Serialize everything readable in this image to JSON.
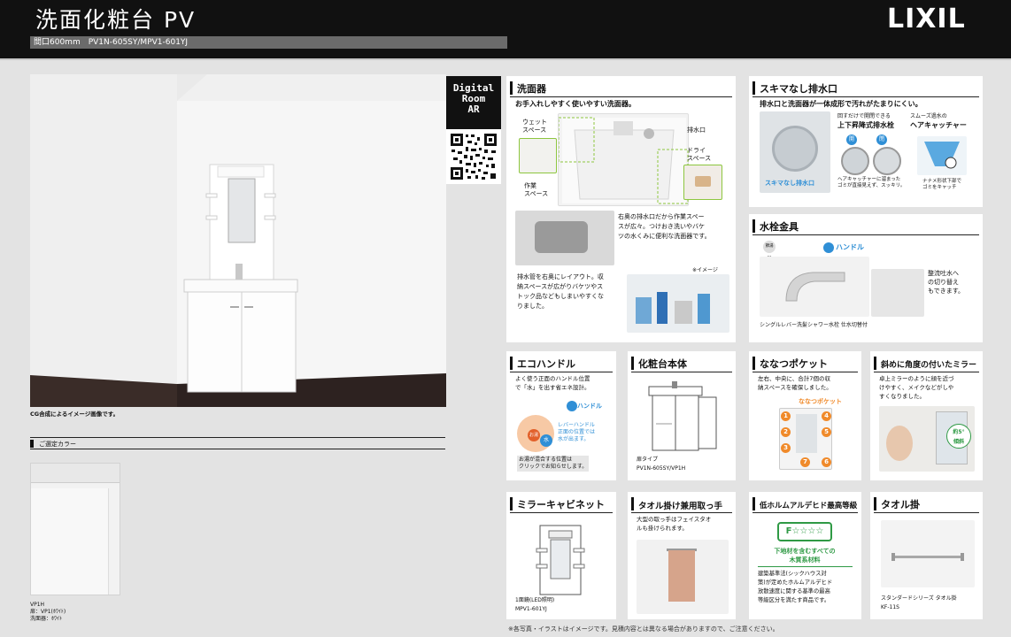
{
  "header": {
    "title": "洗面化粧台 PV",
    "subtitle": "間口600mm　PV1N-605SY/MPV1-601YJ",
    "logo": "LIXIL"
  },
  "ar": {
    "line1": "Digital",
    "line2": "Room",
    "line3": "AR"
  },
  "room": {
    "note": "CG合成によるイメージ画像です。"
  },
  "color": {
    "title": "ご選定カラー",
    "model": "VP1H",
    "door": "扉：VP1(ﾎﾜｲﾄ)",
    "bowl": "洗面器：ﾎﾜｲﾄ"
  },
  "sink": {
    "title": "洗面器",
    "lead": "お手入れしやすく使いやすい洗面器。",
    "wet": [
      "ウェット",
      "スペース"
    ],
    "drain": "排水口",
    "dry": [
      "ドライ",
      "スペース"
    ],
    "work": [
      "作業",
      "スペース"
    ],
    "desc1": [
      "右奥の排水口だから作業スペー",
      "スが広々。つけおき洗いやバケ",
      "ツの水くみに便利な洗面器です。"
    ],
    "image_note": "※イメージ",
    "desc2": [
      "排水管を右奥にレイアウト。収",
      "納スペースが広がりバケツやス",
      "トック品などもしまいやすくな",
      "りました。"
    ]
  },
  "sukima": {
    "title": "スキマなし排水口",
    "lead": "排水口と洗面器が一体成形で汚れがたまりにくい。",
    "sub1": "回すだけで開閉できる",
    "sub2": "スムーズ過水の",
    "head1": "上下昇降式排水栓",
    "head2": "ヘアキャッチャー",
    "photo_label": "スキマなし排水口",
    "cap1": [
      "ヘアキャッチャーに溜まった",
      "ゴミが直接見えず、スッキリ。"
    ],
    "cap2": [
      "ナナメ形状下部で",
      "ゴミをキャッチ"
    ],
    "open": "開",
    "close": "閉"
  },
  "faucet": {
    "title": "水栓金具",
    "badge": "節湯C1",
    "handle": "ハンドル",
    "desc": [
      "整流吐水へ",
      "の切り替え",
      "もできます。"
    ],
    "caption": "シングルレバー洗髪シャワー水栓 仕水切替付"
  },
  "eco": {
    "title": "エコハンドル",
    "desc": [
      "よく使う正面のハンドル位置",
      "で「水」を出す省エネ設計。"
    ],
    "handle": "ハンドル",
    "lever": [
      "レバーハンドル",
      "正面の位置では",
      "水が出ます。"
    ],
    "mix": [
      "お湯が混合する位置は",
      "クリックでお知らせします。"
    ],
    "hot": "お湯",
    "water": "水"
  },
  "cabinet": {
    "title": "化粧台本体",
    "type": "扉タイプ",
    "model": "PV1N-605SY/VP1H"
  },
  "pocket": {
    "title": "ななつポケット",
    "desc": [
      "左右、中央に、合計7個の収",
      "納スペースを確保しました。"
    ],
    "sub": "ななつポケット",
    "nums": [
      "1",
      "2",
      "3",
      "4",
      "5",
      "6",
      "7"
    ]
  },
  "mirror": {
    "title": "斜めに角度の付いたミラー",
    "desc": [
      "卓上ミラーのように顔を近づ",
      "けやすく、メイクなどがしや",
      "すくなりました。"
    ],
    "badge": [
      "約5°",
      "傾斜"
    ]
  },
  "mcab": {
    "title": "ミラーキャビネット",
    "type": "1面鏡(LED照明)",
    "model": "MPV1-601YJ"
  },
  "towelhandle": {
    "title": "タオル掛け兼用取っ手",
    "desc": [
      "大型の取っ手はフェイスタオ",
      "ルも掛けられます。"
    ]
  },
  "formal": {
    "title": "低ホルムアルデヒド最高等級",
    "mark": "F☆☆☆☆",
    "sub": [
      "下地材を含むすべての",
      "木質系材料"
    ],
    "desc": [
      "建築基準法(シックハウス対",
      "策)が定めたホルムアルデヒド",
      "放散速度に関する基準の最高",
      "等級区分を満たす商品です。"
    ]
  },
  "towel": {
    "title": "タオル掛",
    "caption": "スタンダードシリーズ タオル掛",
    "model": "KF-11S"
  },
  "footnote": "※各写真・イラストはイメージです。見積内容とは異なる場合がありますので、ご注意ください。",
  "colors": {
    "accent_orange": "#f08a2a",
    "accent_green": "#2f9a45",
    "accent_blue": "#2f8fd6",
    "header_bg": "#111111"
  }
}
